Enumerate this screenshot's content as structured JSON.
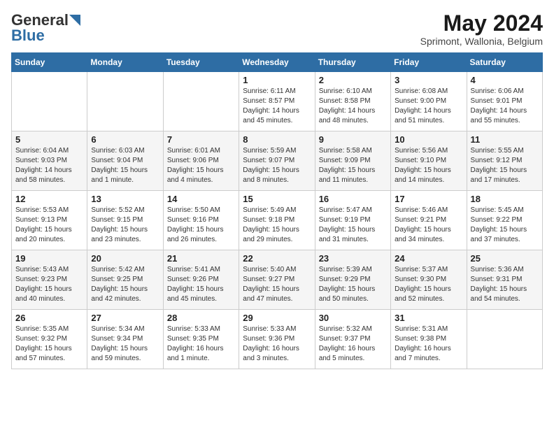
{
  "header": {
    "logo_general": "General",
    "logo_blue": "Blue",
    "title": "May 2024",
    "subtitle": "Sprimont, Wallonia, Belgium"
  },
  "days_of_week": [
    "Sunday",
    "Monday",
    "Tuesday",
    "Wednesday",
    "Thursday",
    "Friday",
    "Saturday"
  ],
  "weeks": [
    [
      {
        "day": "",
        "content": ""
      },
      {
        "day": "",
        "content": ""
      },
      {
        "day": "",
        "content": ""
      },
      {
        "day": "1",
        "content": "Sunrise: 6:11 AM\nSunset: 8:57 PM\nDaylight: 14 hours\nand 45 minutes."
      },
      {
        "day": "2",
        "content": "Sunrise: 6:10 AM\nSunset: 8:58 PM\nDaylight: 14 hours\nand 48 minutes."
      },
      {
        "day": "3",
        "content": "Sunrise: 6:08 AM\nSunset: 9:00 PM\nDaylight: 14 hours\nand 51 minutes."
      },
      {
        "day": "4",
        "content": "Sunrise: 6:06 AM\nSunset: 9:01 PM\nDaylight: 14 hours\nand 55 minutes."
      }
    ],
    [
      {
        "day": "5",
        "content": "Sunrise: 6:04 AM\nSunset: 9:03 PM\nDaylight: 14 hours\nand 58 minutes."
      },
      {
        "day": "6",
        "content": "Sunrise: 6:03 AM\nSunset: 9:04 PM\nDaylight: 15 hours\nand 1 minute."
      },
      {
        "day": "7",
        "content": "Sunrise: 6:01 AM\nSunset: 9:06 PM\nDaylight: 15 hours\nand 4 minutes."
      },
      {
        "day": "8",
        "content": "Sunrise: 5:59 AM\nSunset: 9:07 PM\nDaylight: 15 hours\nand 8 minutes."
      },
      {
        "day": "9",
        "content": "Sunrise: 5:58 AM\nSunset: 9:09 PM\nDaylight: 15 hours\nand 11 minutes."
      },
      {
        "day": "10",
        "content": "Sunrise: 5:56 AM\nSunset: 9:10 PM\nDaylight: 15 hours\nand 14 minutes."
      },
      {
        "day": "11",
        "content": "Sunrise: 5:55 AM\nSunset: 9:12 PM\nDaylight: 15 hours\nand 17 minutes."
      }
    ],
    [
      {
        "day": "12",
        "content": "Sunrise: 5:53 AM\nSunset: 9:13 PM\nDaylight: 15 hours\nand 20 minutes."
      },
      {
        "day": "13",
        "content": "Sunrise: 5:52 AM\nSunset: 9:15 PM\nDaylight: 15 hours\nand 23 minutes."
      },
      {
        "day": "14",
        "content": "Sunrise: 5:50 AM\nSunset: 9:16 PM\nDaylight: 15 hours\nand 26 minutes."
      },
      {
        "day": "15",
        "content": "Sunrise: 5:49 AM\nSunset: 9:18 PM\nDaylight: 15 hours\nand 29 minutes."
      },
      {
        "day": "16",
        "content": "Sunrise: 5:47 AM\nSunset: 9:19 PM\nDaylight: 15 hours\nand 31 minutes."
      },
      {
        "day": "17",
        "content": "Sunrise: 5:46 AM\nSunset: 9:21 PM\nDaylight: 15 hours\nand 34 minutes."
      },
      {
        "day": "18",
        "content": "Sunrise: 5:45 AM\nSunset: 9:22 PM\nDaylight: 15 hours\nand 37 minutes."
      }
    ],
    [
      {
        "day": "19",
        "content": "Sunrise: 5:43 AM\nSunset: 9:23 PM\nDaylight: 15 hours\nand 40 minutes."
      },
      {
        "day": "20",
        "content": "Sunrise: 5:42 AM\nSunset: 9:25 PM\nDaylight: 15 hours\nand 42 minutes."
      },
      {
        "day": "21",
        "content": "Sunrise: 5:41 AM\nSunset: 9:26 PM\nDaylight: 15 hours\nand 45 minutes."
      },
      {
        "day": "22",
        "content": "Sunrise: 5:40 AM\nSunset: 9:27 PM\nDaylight: 15 hours\nand 47 minutes."
      },
      {
        "day": "23",
        "content": "Sunrise: 5:39 AM\nSunset: 9:29 PM\nDaylight: 15 hours\nand 50 minutes."
      },
      {
        "day": "24",
        "content": "Sunrise: 5:37 AM\nSunset: 9:30 PM\nDaylight: 15 hours\nand 52 minutes."
      },
      {
        "day": "25",
        "content": "Sunrise: 5:36 AM\nSunset: 9:31 PM\nDaylight: 15 hours\nand 54 minutes."
      }
    ],
    [
      {
        "day": "26",
        "content": "Sunrise: 5:35 AM\nSunset: 9:32 PM\nDaylight: 15 hours\nand 57 minutes."
      },
      {
        "day": "27",
        "content": "Sunrise: 5:34 AM\nSunset: 9:34 PM\nDaylight: 15 hours\nand 59 minutes."
      },
      {
        "day": "28",
        "content": "Sunrise: 5:33 AM\nSunset: 9:35 PM\nDaylight: 16 hours\nand 1 minute."
      },
      {
        "day": "29",
        "content": "Sunrise: 5:33 AM\nSunset: 9:36 PM\nDaylight: 16 hours\nand 3 minutes."
      },
      {
        "day": "30",
        "content": "Sunrise: 5:32 AM\nSunset: 9:37 PM\nDaylight: 16 hours\nand 5 minutes."
      },
      {
        "day": "31",
        "content": "Sunrise: 5:31 AM\nSunset: 9:38 PM\nDaylight: 16 hours\nand 7 minutes."
      },
      {
        "day": "",
        "content": ""
      }
    ]
  ]
}
